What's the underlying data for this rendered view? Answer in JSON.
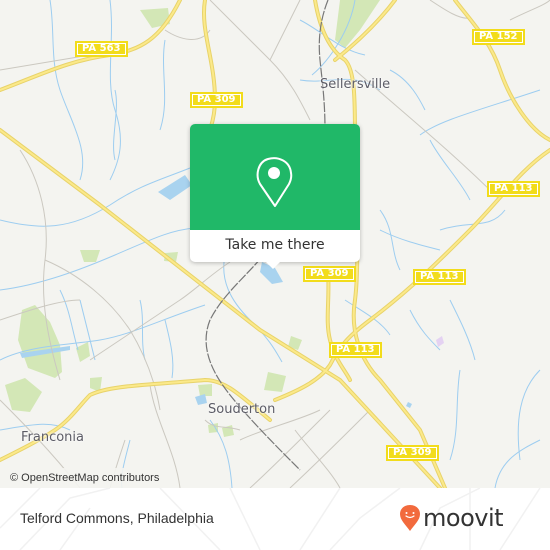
{
  "map": {
    "places": [
      {
        "id": "sellersville",
        "name": "Sellersville"
      },
      {
        "id": "souderton",
        "name": "Souderton"
      },
      {
        "id": "franconia",
        "name": "Franconia"
      }
    ],
    "route_shields": [
      {
        "id": "pa563",
        "label": "PA 563"
      },
      {
        "id": "pa309-north",
        "label": "PA 309"
      },
      {
        "id": "pa152",
        "label": "PA 152"
      },
      {
        "id": "pa113-east",
        "label": "PA 113"
      },
      {
        "id": "pa113-mid",
        "label": "PA 113"
      },
      {
        "id": "pa309-center",
        "label": "PA 309"
      },
      {
        "id": "pa113-south",
        "label": "PA 113"
      },
      {
        "id": "pa309-south",
        "label": "PA 309"
      }
    ],
    "attribution": "© OpenStreetMap contributors"
  },
  "popup": {
    "icon": "map-pin-icon",
    "button_label": "Take me there",
    "accent_color": "#20b868"
  },
  "footer": {
    "location_title": "Telford Commons, Philadelphia",
    "brand": "moovit",
    "brand_icon": "moovit-pin-smile-icon",
    "brand_color": "#f26a3d"
  }
}
